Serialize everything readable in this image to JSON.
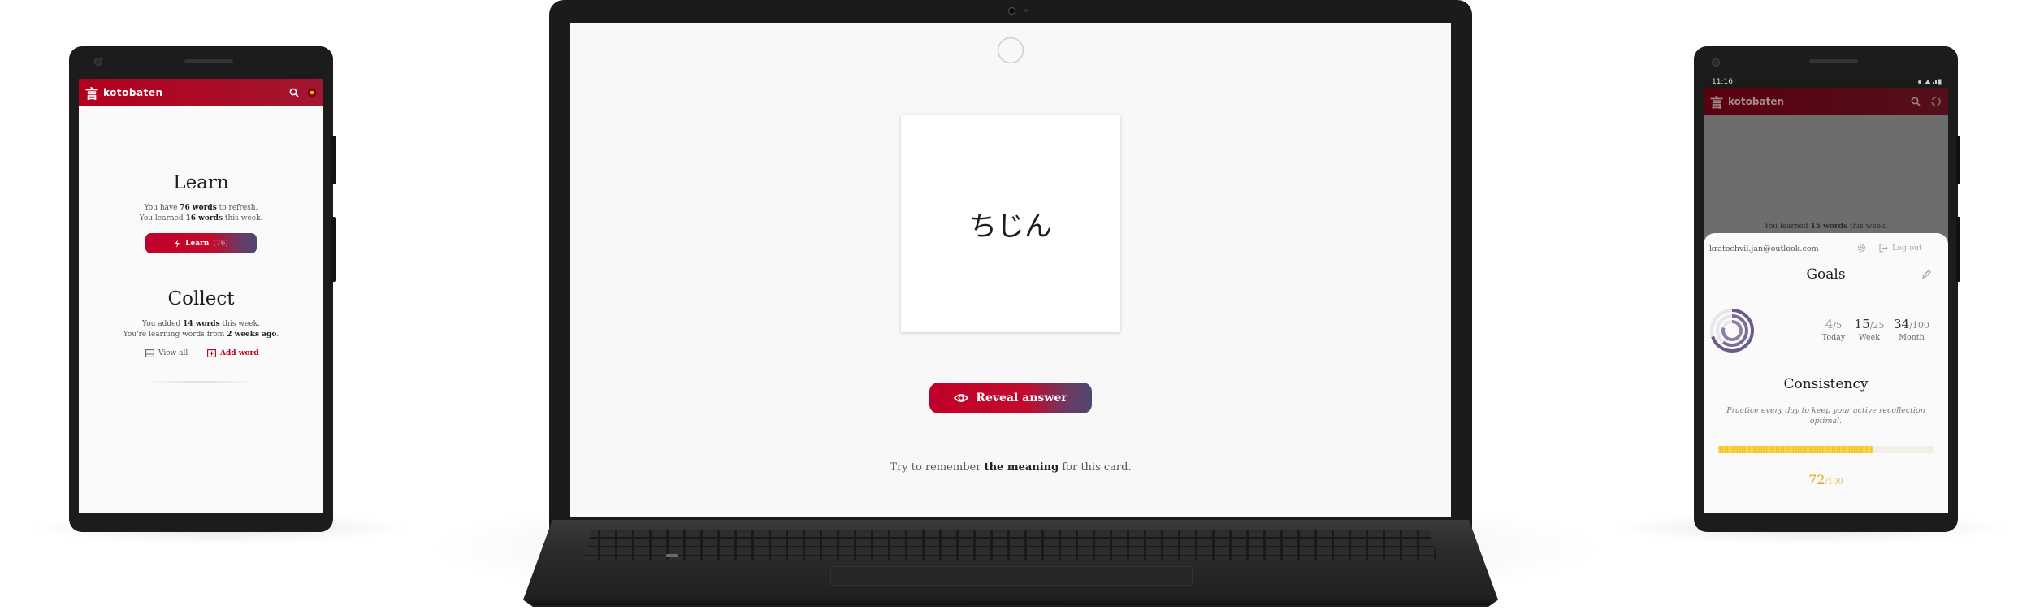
{
  "left_phone": {
    "app_name": "kotobaten",
    "logo_glyph": "言",
    "learn": {
      "title": "Learn",
      "line1_pre": "You have ",
      "line1_bold": "76 words",
      "line1_post": " to refresh.",
      "line2_pre": "You learned ",
      "line2_bold": "16 words",
      "line2_post": " this week.",
      "button_label": "Learn",
      "button_suffix": "(76)"
    },
    "collect": {
      "title": "Collect",
      "line1_pre": "You added ",
      "line1_bold": "14 words",
      "line1_post": " this week.",
      "line2_pre": "You're learning words from ",
      "line2_bold": "2 weeks ago",
      "line2_post": ".",
      "view_all_label": "View all",
      "add_word_label": "Add word"
    }
  },
  "laptop": {
    "card_text": "ちじん",
    "reveal_label": "Reveal answer",
    "hint_pre": "Try to remember ",
    "hint_bold": "the meaning",
    "hint_post": " for this card."
  },
  "right_phone": {
    "status_time": "11:16",
    "app_name": "kotobaten",
    "logo_glyph": "言",
    "background_text_pre": "You learned ",
    "background_text_bold": "15 words",
    "background_text_post": " this week.",
    "email": "kratochvil.jan@outlook.com",
    "logout_label": "Log out",
    "goals_title": "Goals",
    "goals": [
      {
        "value": "4",
        "target": "/5",
        "label": "Today"
      },
      {
        "value": "15",
        "target": "/25",
        "label": "Week"
      },
      {
        "value": "34",
        "target": "/100",
        "label": "Month"
      }
    ],
    "consistency_title": "Consistency",
    "consistency_desc": "Practice every day to keep your active recollection optimal.",
    "consistency_value": "72",
    "consistency_target": "/100",
    "consistency_fraction": 0.72
  },
  "colors": {
    "brand_red": "#b3001e",
    "brand_purple": "#4e4770",
    "consistency_yellow": "#f5c518"
  }
}
